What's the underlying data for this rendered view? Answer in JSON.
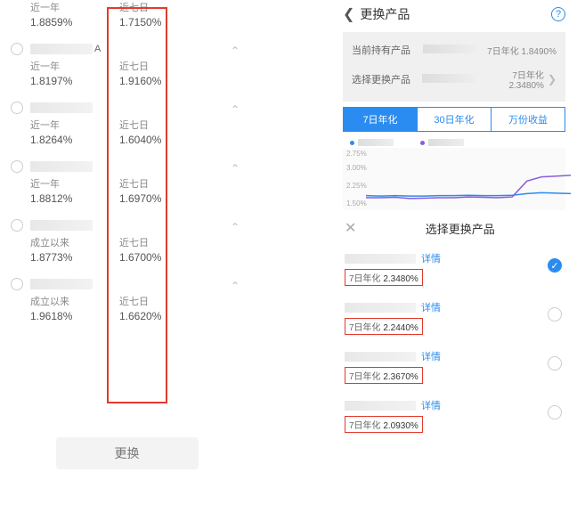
{
  "left": {
    "label_year": "近一年",
    "label_since": "成立以来",
    "label_7d": "近七日",
    "rows": [
      {
        "left_label": "近一年",
        "left_val": "1.8859%",
        "rate7": "1.7150%",
        "has_radio": false,
        "has_chevron": false
      },
      {
        "left_label": "近一年",
        "left_val": "1.8197%",
        "rate7": "1.9160%",
        "has_radio": true,
        "has_chevron": true,
        "name_suffix": "A"
      },
      {
        "left_label": "近一年",
        "left_val": "1.8264%",
        "rate7": "1.6040%",
        "has_radio": true,
        "has_chevron": true
      },
      {
        "left_label": "近一年",
        "left_val": "1.8812%",
        "rate7": "1.6970%",
        "has_radio": true,
        "has_chevron": true
      },
      {
        "left_label": "成立以来",
        "left_val": "1.8773%",
        "rate7": "1.6700%",
        "has_radio": true,
        "has_chevron": true
      },
      {
        "left_label": "成立以来",
        "left_val": "1.9618%",
        "rate7": "1.6620%",
        "has_radio": true,
        "has_chevron": true
      }
    ],
    "swap_button": "更换"
  },
  "right": {
    "header_title": "更换产品",
    "current_label": "当前持有产品",
    "current_rate_label": "7日年化",
    "current_rate": "1.8490%",
    "select_label": "选择更换产品",
    "select_rate_label": "7日年化",
    "select_rate": "2.3480%",
    "tabs": [
      "7日年化",
      "30日年化",
      "万份收益"
    ],
    "active_tab": 0,
    "legend_colors": [
      "#2a8cf0",
      "#8a5cd9"
    ],
    "chart_data": {
      "type": "line",
      "ylim": [
        1.5,
        3.0
      ],
      "yticks": [
        "2.75%",
        "3.00%",
        "2.25%",
        "1.50%"
      ],
      "series": [
        {
          "name": "current",
          "color": "#2a8cf0",
          "values": [
            1.85,
            1.84,
            1.85,
            1.84,
            1.84,
            1.85,
            1.85,
            1.86,
            1.85,
            1.85,
            1.86,
            1.9,
            1.92,
            1.91,
            1.9
          ]
        },
        {
          "name": "selected",
          "color": "#8a5cd9",
          "values": [
            1.8,
            1.8,
            1.81,
            1.78,
            1.79,
            1.8,
            1.8,
            1.82,
            1.81,
            1.8,
            1.82,
            2.2,
            2.3,
            2.32,
            2.34
          ]
        }
      ]
    },
    "sheet_title": "选择更换产品",
    "detail_label": "详情",
    "rate_label": "7日年化",
    "options": [
      {
        "rate": "2.3480%",
        "checked": true
      },
      {
        "rate": "2.2440%",
        "checked": false
      },
      {
        "rate": "2.3670%",
        "checked": false
      },
      {
        "rate": "2.0930%",
        "checked": false
      }
    ]
  }
}
